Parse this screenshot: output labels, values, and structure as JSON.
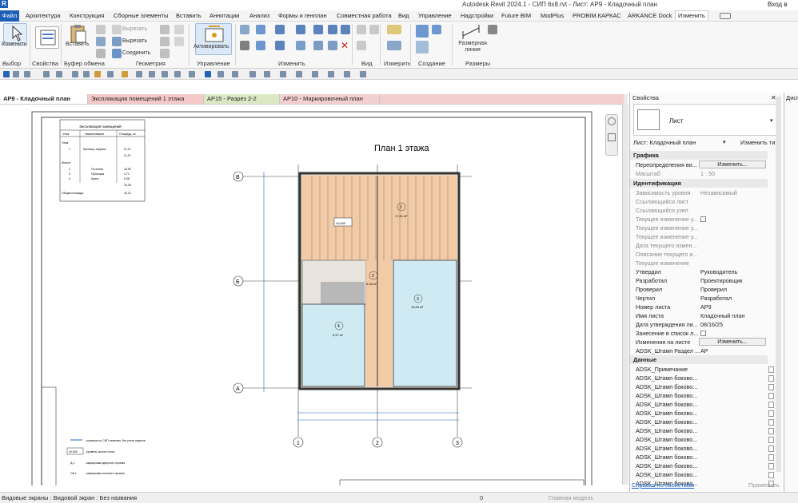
{
  "window": {
    "title": "Autodesk Revit 2024.1 - СИП 6х8.rvt - Лист: АР9 - Кладочный план",
    "account": "Вход в"
  },
  "menu": {
    "file": "Файл",
    "items": [
      "Архитектура",
      "Конструкция",
      "Сборные элементы",
      "Вставить",
      "Аннотации",
      "Анализ",
      "Формы и генплан",
      "Совместная работа",
      "Вид",
      "Управление",
      "Надстройки",
      "Future BIM",
      "ModPlus",
      "PROBIM.КАРКАС",
      "ARKANCE Dock",
      "Изменить"
    ]
  },
  "ribbon": {
    "modify_label": "Изменить",
    "select_label": "Выбор",
    "properties_label": "Свойства",
    "paste_label": "Вставить",
    "clipboard_label": "Буфер обмена",
    "cut_label": "Вырезать",
    "copy_label": "Вырезать",
    "join_label": "Соединить",
    "geometry_label": "Геометрия",
    "activate_label": "Активировать",
    "control_label": "Управление",
    "modify_group": "Изменить",
    "view_label": "Вид",
    "measure_label": "Измерить",
    "create_label": "Создание",
    "dim_label": "Размерная линия",
    "dims_group": "Размеры"
  },
  "tabs": [
    "АР9 - Кладочный план",
    "Экспликация помещений 1 этажа",
    "АР15 - Разрез 2-2",
    "АР10 - Маркировочный план"
  ],
  "drawing": {
    "plan_title": "План 1 этажа",
    "schedule_title": "Экспликация помещений",
    "schedule_headers": [
      "Этаж",
      "Наименование",
      "Площадь, м²"
    ],
    "schedule_rows": [
      [
        "Этаж",
        "",
        " "
      ],
      [
        "1",
        "Крыльцо-терраса",
        "11,21"
      ],
      [
        "",
        "",
        "11,21"
      ],
      [
        "Жилое",
        "",
        ""
      ],
      [
        "2",
        "Гостиная",
        "18,59"
      ],
      [
        "3",
        "Прихожая",
        "4,71"
      ],
      [
        "4",
        "Кухня",
        "5,98"
      ],
      [
        "",
        "",
        "29,28"
      ],
      [
        "Общая площадь:",
        "",
        "42,10"
      ]
    ],
    "grid_rows": [
      "В",
      "Б",
      "А"
    ],
    "grid_cols": [
      "1",
      "2",
      "3"
    ],
    "room_areas": [
      "17,31 м²",
      "5,33 м²",
      "18,59 м²",
      "5,97 м²"
    ],
    "room_tags": [
      "1",
      "2",
      "3",
      "4"
    ],
    "level_mark": "±0,000",
    "legend": [
      "- размеры по СИП панелям, без учета отделки",
      "- уровень чистого пола",
      "- маркировка дверного проема",
      "- маркировка оконного проема"
    ],
    "legend_codes": [
      "±0,000",
      "Д-1",
      "ОК-1"
    ]
  },
  "properties": {
    "header": "Свойства",
    "type": "Лист",
    "selector": "Лист: Кладочный план",
    "edit_type": "Изменить тип",
    "groups": {
      "graphics": "Графика",
      "ident": "Идентификация",
      "data": "Данные"
    },
    "rows_graphics": [
      [
        "Переопределения ви...",
        "Изменить..."
      ],
      [
        "Масштаб",
        "1 : 50"
      ]
    ],
    "rows_ident": [
      [
        "Зависимость уровня",
        "Независимый"
      ],
      [
        "Ссылающийся лист",
        ""
      ],
      [
        "Ссылающийся узел",
        ""
      ],
      [
        "Текущее изменение у...",
        ""
      ],
      [
        "Текущее изменение у...",
        ""
      ],
      [
        "Текущее изменение у...",
        ""
      ],
      [
        "Дата текущего измен...",
        ""
      ],
      [
        "Описание текущего и...",
        ""
      ],
      [
        "Текущее изменение",
        ""
      ],
      [
        "Утвердил",
        "Руководитель"
      ],
      [
        "Разработал",
        "Проектировщик"
      ],
      [
        "Проверил",
        "Проверил"
      ],
      [
        "Чертил",
        "Разработал"
      ],
      [
        "Номер листа",
        "АР9"
      ],
      [
        "Имя листа",
        "Кладочный план"
      ],
      [
        "Дата утверждения ли...",
        "08/16/25"
      ],
      [
        "Занесение в список л...",
        ""
      ],
      [
        "Изменения на листе",
        "Изменить..."
      ],
      [
        "ADSK_Штамп Раздел ...",
        "АР"
      ]
    ],
    "rows_data": [
      "ADSK_Примечание",
      "ADSK_Штамп боково...",
      "ADSK_Штамп боково...",
      "ADSK_Штамп боково...",
      "ADSK_Штамп боково...",
      "ADSK_Штамп боково...",
      "ADSK_Штамп боково...",
      "ADSK_Штамп боково...",
      "ADSK_Штамп боково...",
      "ADSK_Штамп боково...",
      "ADSK_Штамп боково...",
      "ADSK_Штамп боково...",
      "ADSK_Штамп боково...",
      "ADSK_Штамп боково..."
    ],
    "help": "Справка по свойствам",
    "apply": "Применить"
  },
  "browser": {
    "title": "Дисп"
  },
  "status": {
    "text": "Видовые экраны : Видовой экран : Без названия",
    "model": "Главная модель",
    "zero": "0"
  }
}
